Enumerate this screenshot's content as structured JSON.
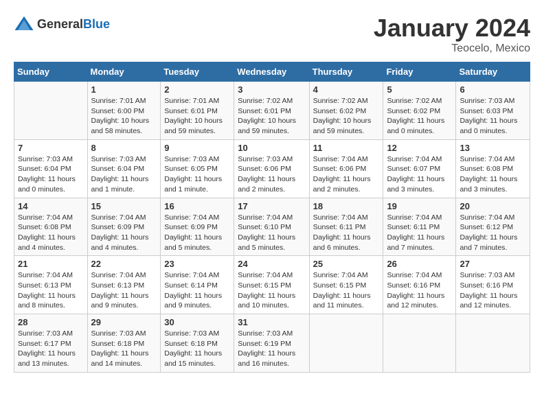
{
  "header": {
    "logo_general": "General",
    "logo_blue": "Blue",
    "title": "January 2024",
    "location": "Teocelo, Mexico"
  },
  "columns": [
    "Sunday",
    "Monday",
    "Tuesday",
    "Wednesday",
    "Thursday",
    "Friday",
    "Saturday"
  ],
  "weeks": [
    [
      {
        "day": "",
        "info": ""
      },
      {
        "day": "1",
        "info": "Sunrise: 7:01 AM\nSunset: 6:00 PM\nDaylight: 10 hours\nand 58 minutes."
      },
      {
        "day": "2",
        "info": "Sunrise: 7:01 AM\nSunset: 6:01 PM\nDaylight: 10 hours\nand 59 minutes."
      },
      {
        "day": "3",
        "info": "Sunrise: 7:02 AM\nSunset: 6:01 PM\nDaylight: 10 hours\nand 59 minutes."
      },
      {
        "day": "4",
        "info": "Sunrise: 7:02 AM\nSunset: 6:02 PM\nDaylight: 10 hours\nand 59 minutes."
      },
      {
        "day": "5",
        "info": "Sunrise: 7:02 AM\nSunset: 6:02 PM\nDaylight: 11 hours\nand 0 minutes."
      },
      {
        "day": "6",
        "info": "Sunrise: 7:03 AM\nSunset: 6:03 PM\nDaylight: 11 hours\nand 0 minutes."
      }
    ],
    [
      {
        "day": "7",
        "info": "Sunrise: 7:03 AM\nSunset: 6:04 PM\nDaylight: 11 hours\nand 0 minutes."
      },
      {
        "day": "8",
        "info": "Sunrise: 7:03 AM\nSunset: 6:04 PM\nDaylight: 11 hours\nand 1 minute."
      },
      {
        "day": "9",
        "info": "Sunrise: 7:03 AM\nSunset: 6:05 PM\nDaylight: 11 hours\nand 1 minute."
      },
      {
        "day": "10",
        "info": "Sunrise: 7:03 AM\nSunset: 6:06 PM\nDaylight: 11 hours\nand 2 minutes."
      },
      {
        "day": "11",
        "info": "Sunrise: 7:04 AM\nSunset: 6:06 PM\nDaylight: 11 hours\nand 2 minutes."
      },
      {
        "day": "12",
        "info": "Sunrise: 7:04 AM\nSunset: 6:07 PM\nDaylight: 11 hours\nand 3 minutes."
      },
      {
        "day": "13",
        "info": "Sunrise: 7:04 AM\nSunset: 6:08 PM\nDaylight: 11 hours\nand 3 minutes."
      }
    ],
    [
      {
        "day": "14",
        "info": "Sunrise: 7:04 AM\nSunset: 6:08 PM\nDaylight: 11 hours\nand 4 minutes."
      },
      {
        "day": "15",
        "info": "Sunrise: 7:04 AM\nSunset: 6:09 PM\nDaylight: 11 hours\nand 4 minutes."
      },
      {
        "day": "16",
        "info": "Sunrise: 7:04 AM\nSunset: 6:09 PM\nDaylight: 11 hours\nand 5 minutes."
      },
      {
        "day": "17",
        "info": "Sunrise: 7:04 AM\nSunset: 6:10 PM\nDaylight: 11 hours\nand 5 minutes."
      },
      {
        "day": "18",
        "info": "Sunrise: 7:04 AM\nSunset: 6:11 PM\nDaylight: 11 hours\nand 6 minutes."
      },
      {
        "day": "19",
        "info": "Sunrise: 7:04 AM\nSunset: 6:11 PM\nDaylight: 11 hours\nand 7 minutes."
      },
      {
        "day": "20",
        "info": "Sunrise: 7:04 AM\nSunset: 6:12 PM\nDaylight: 11 hours\nand 7 minutes."
      }
    ],
    [
      {
        "day": "21",
        "info": "Sunrise: 7:04 AM\nSunset: 6:13 PM\nDaylight: 11 hours\nand 8 minutes."
      },
      {
        "day": "22",
        "info": "Sunrise: 7:04 AM\nSunset: 6:13 PM\nDaylight: 11 hours\nand 9 minutes."
      },
      {
        "day": "23",
        "info": "Sunrise: 7:04 AM\nSunset: 6:14 PM\nDaylight: 11 hours\nand 9 minutes."
      },
      {
        "day": "24",
        "info": "Sunrise: 7:04 AM\nSunset: 6:15 PM\nDaylight: 11 hours\nand 10 minutes."
      },
      {
        "day": "25",
        "info": "Sunrise: 7:04 AM\nSunset: 6:15 PM\nDaylight: 11 hours\nand 11 minutes."
      },
      {
        "day": "26",
        "info": "Sunrise: 7:04 AM\nSunset: 6:16 PM\nDaylight: 11 hours\nand 12 minutes."
      },
      {
        "day": "27",
        "info": "Sunrise: 7:03 AM\nSunset: 6:16 PM\nDaylight: 11 hours\nand 12 minutes."
      }
    ],
    [
      {
        "day": "28",
        "info": "Sunrise: 7:03 AM\nSunset: 6:17 PM\nDaylight: 11 hours\nand 13 minutes."
      },
      {
        "day": "29",
        "info": "Sunrise: 7:03 AM\nSunset: 6:18 PM\nDaylight: 11 hours\nand 14 minutes."
      },
      {
        "day": "30",
        "info": "Sunrise: 7:03 AM\nSunset: 6:18 PM\nDaylight: 11 hours\nand 15 minutes."
      },
      {
        "day": "31",
        "info": "Sunrise: 7:03 AM\nSunset: 6:19 PM\nDaylight: 11 hours\nand 16 minutes."
      },
      {
        "day": "",
        "info": ""
      },
      {
        "day": "",
        "info": ""
      },
      {
        "day": "",
        "info": ""
      }
    ]
  ]
}
